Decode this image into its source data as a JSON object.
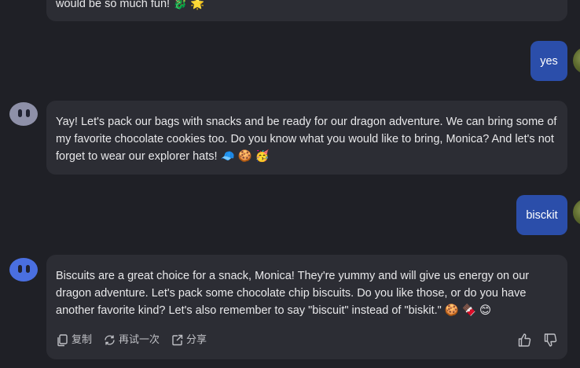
{
  "messages": {
    "prev_ai_tail": "would be so much fun! 🐉 🌟",
    "user_1": "yes",
    "ai_1": "Yay! Let's pack our bags with snacks and be ready for our dragon adventure. We can bring some of my favorite chocolate cookies too. Do you know what you would like to bring, Monica? And let's not forget to wear our explorer hats! 🧢 🍪 🥳",
    "user_2": "bisckit",
    "ai_2": "Biscuits are a great choice for a snack, Monica! They're yummy and will give us energy on our dragon adventure. Let's pack some chocolate chip biscuits. Do you like those, or do you have another favorite kind? Let's also remember to say \"biscuit\" instead of \"biskit.\" 🍪 🍫 😊"
  },
  "actions": {
    "copy_label": "复制",
    "retry_label": "再试一次",
    "share_label": "分享"
  },
  "colors": {
    "background": "#1f2026",
    "ai_bubble": "#2c2d34",
    "user_bubble": "#2b4eaa",
    "ai_avatar_grey": "#8e90a8",
    "ai_avatar_blue": "#4a6fe0"
  }
}
